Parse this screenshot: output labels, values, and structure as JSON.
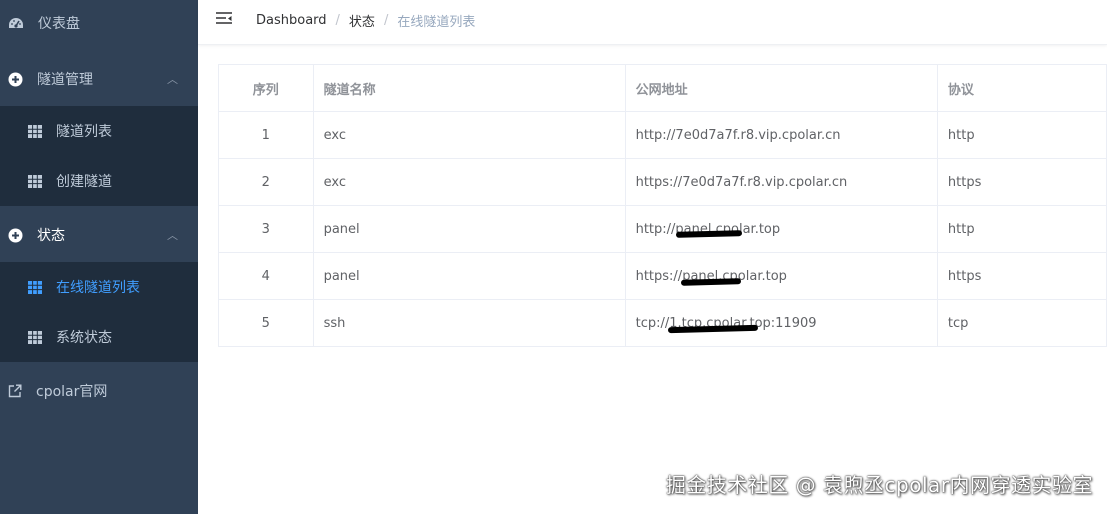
{
  "sidebar": {
    "dashboard": "仪表盘",
    "tunnel_mgmt": {
      "label": "隧道管理",
      "items": [
        "隧道列表",
        "创建隧道"
      ]
    },
    "status": {
      "label": "状态",
      "items": [
        "在线隧道列表",
        "系统状态"
      ]
    },
    "cpolar_site": "cpolar官网"
  },
  "breadcrumb": [
    "Dashboard",
    "状态",
    "在线隧道列表"
  ],
  "table": {
    "headers": [
      "序列",
      "隧道名称",
      "公网地址",
      "协议"
    ],
    "rows": [
      [
        "1",
        "exc",
        "http://7e0d7a7f.r8.vip.cpolar.cn",
        "http"
      ],
      [
        "2",
        "exc",
        "https://7e0d7a7f.r8.vip.cpolar.cn",
        "https"
      ],
      [
        "3",
        "panel",
        "http://panel.cpolar.top",
        "http"
      ],
      [
        "4",
        "panel",
        "https://panel.cpolar.top",
        "https"
      ],
      [
        "5",
        "ssh",
        "tcp://1.tcp.cpolar.top:11909",
        "tcp"
      ]
    ]
  },
  "watermark": "掘金技术社区 @ 袁煦丞cpolar内网穿透实验室",
  "colors": {
    "sidebar_bg": "#304156",
    "submenu_bg": "#1f2d3d",
    "active": "#409eff"
  }
}
